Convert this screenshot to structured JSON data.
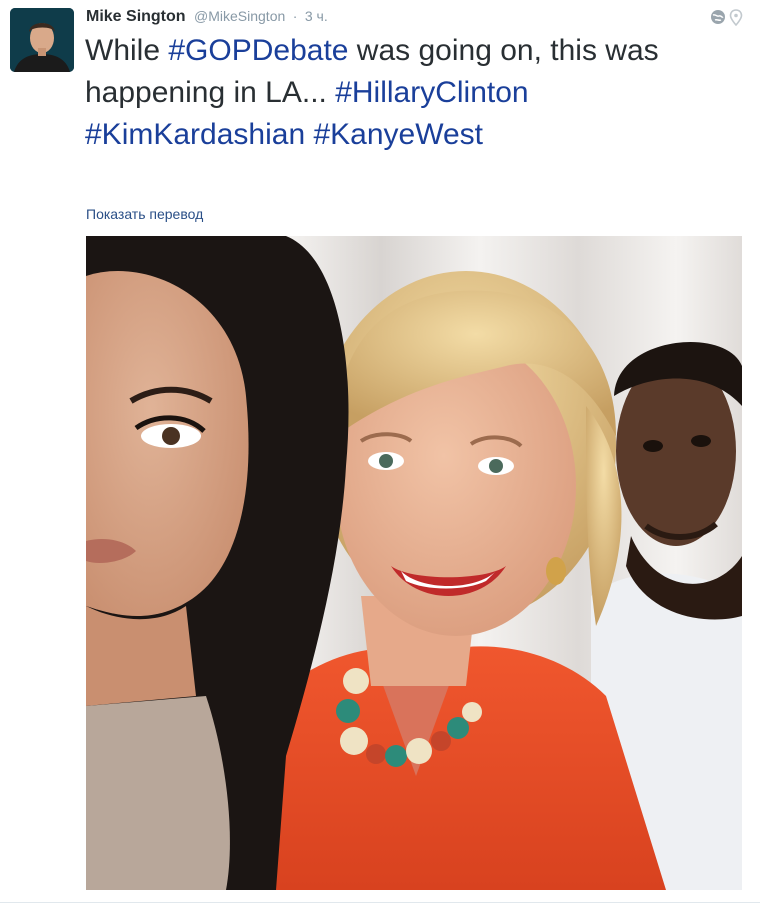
{
  "tweet": {
    "author": {
      "full_name": "Mike Sington",
      "username": "@MikeSington",
      "separator": "·",
      "timestamp": "3 ч."
    },
    "text": {
      "segment_1": "While ",
      "hashtag_1": "#GOPDebate",
      "segment_2": " was going on, this was happening in LA... ",
      "hashtag_2": "#HillaryClinton",
      "segment_3": " ",
      "hashtag_3": "#KimKardashian",
      "segment_4": " ",
      "hashtag_4": "#KanyeWest"
    },
    "translate_label": "Показать перевод",
    "icons": {
      "globe": "globe-icon",
      "location": "location-pin-icon"
    },
    "colors": {
      "hashtag": "#1a3f9a",
      "link": "#2a4f87",
      "meta": "#8899a6"
    }
  }
}
